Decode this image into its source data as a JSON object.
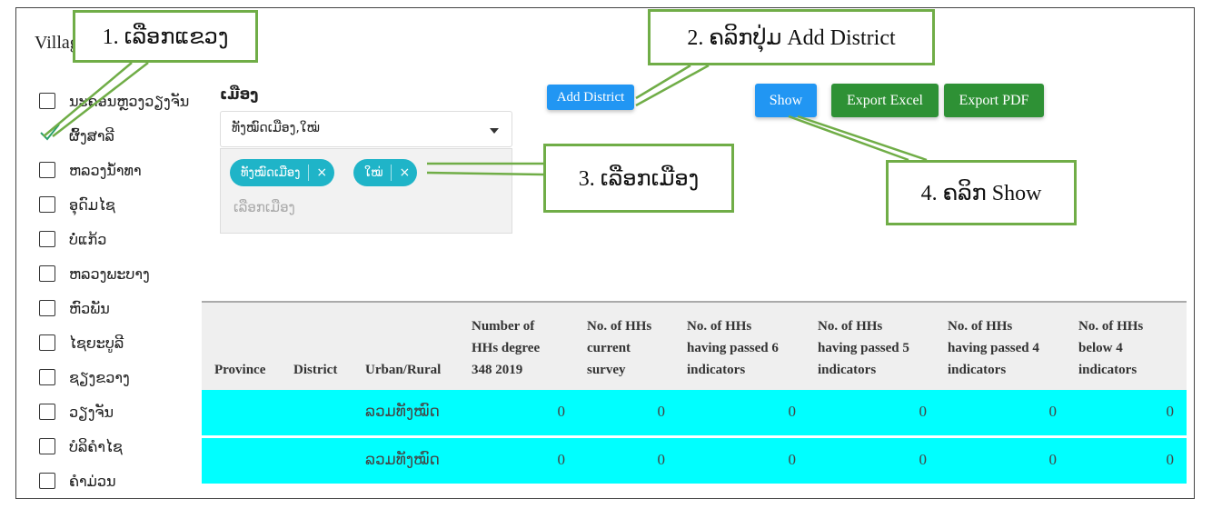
{
  "page": {
    "title": "Village to degree"
  },
  "provinces": [
    {
      "label": "ນະຄອນຫຼວງວຽງຈັນ",
      "checked": false
    },
    {
      "label": "ຜົ້ງສາລີ",
      "checked": true
    },
    {
      "label": "ຫລວງນໍ້າທາ",
      "checked": false
    },
    {
      "label": "ອຸດົມໄຊ",
      "checked": false
    },
    {
      "label": "ບໍ່ແກ້ວ",
      "checked": false
    },
    {
      "label": "ຫລວງພະບາງ",
      "checked": false
    },
    {
      "label": "ຫົວພັນ",
      "checked": false
    },
    {
      "label": "ໄຊຍະບູລີ",
      "checked": false
    },
    {
      "label": "ຊຽງຂວາງ",
      "checked": false
    },
    {
      "label": "ວຽງຈັນ",
      "checked": false
    },
    {
      "label": "ບໍລິຄຳໄຊ",
      "checked": false
    },
    {
      "label": "ຄຳມ່ວນ",
      "checked": false
    }
  ],
  "district": {
    "label": "ເມືອງ",
    "selected_text": "ທັງໝົດເມືອງ,ໃໝ່",
    "tags": [
      {
        "label": "ທັງໝົດເມືອງ"
      },
      {
        "label": "ໃໝ່"
      }
    ],
    "tag_remove": "×",
    "search_placeholder": "ເລືອກເມືອງ"
  },
  "buttons": {
    "add_district": "Add District",
    "show": "Show",
    "export_excel": "Export Excel",
    "export_pdf": "Export PDF"
  },
  "callouts": {
    "step1": "1. ເລືອກແຂວງ",
    "step2": "2. ຄລິກປຸ່ມ Add District",
    "step3": "3. ເລືອກເມືອງ",
    "step4": "4. ຄລິກ Show"
  },
  "table": {
    "headers": {
      "province": "Province",
      "district": "District",
      "urban_rural": "Urban/Rural",
      "hhs_degree": [
        "Number of",
        "HHs degree",
        "348 2019"
      ],
      "hhs_current": [
        "No. of HHs",
        "current",
        "survey"
      ],
      "passed6": [
        "No. of HHs",
        "having passed 6",
        "indicators"
      ],
      "passed5": [
        "No. of HHs",
        "having passed 5",
        "indicators"
      ],
      "passed4": [
        "No. of HHs",
        "having passed 4",
        "indicators"
      ],
      "below4": [
        "No. of HHs",
        "below 4",
        "indicators"
      ]
    },
    "rows": [
      {
        "province": "",
        "district": "",
        "urban_rural": "ລວມທັງໝົດ",
        "hhs_degree": "0",
        "hhs_current": "0",
        "passed6": "0",
        "passed5": "0",
        "passed4": "0",
        "below4": "0"
      },
      {
        "province": "",
        "district": "",
        "urban_rural": "ລວມທັງໝົດ",
        "hhs_degree": "0",
        "hhs_current": "0",
        "passed6": "0",
        "passed5": "0",
        "passed4": "0",
        "below4": "0"
      }
    ]
  },
  "colors": {
    "accent_blue": "#2196f3",
    "export_green": "#2e9135",
    "tag_teal": "#1fb4c8",
    "row_cyan": "#00ffff",
    "callout_border": "#70ad47"
  }
}
